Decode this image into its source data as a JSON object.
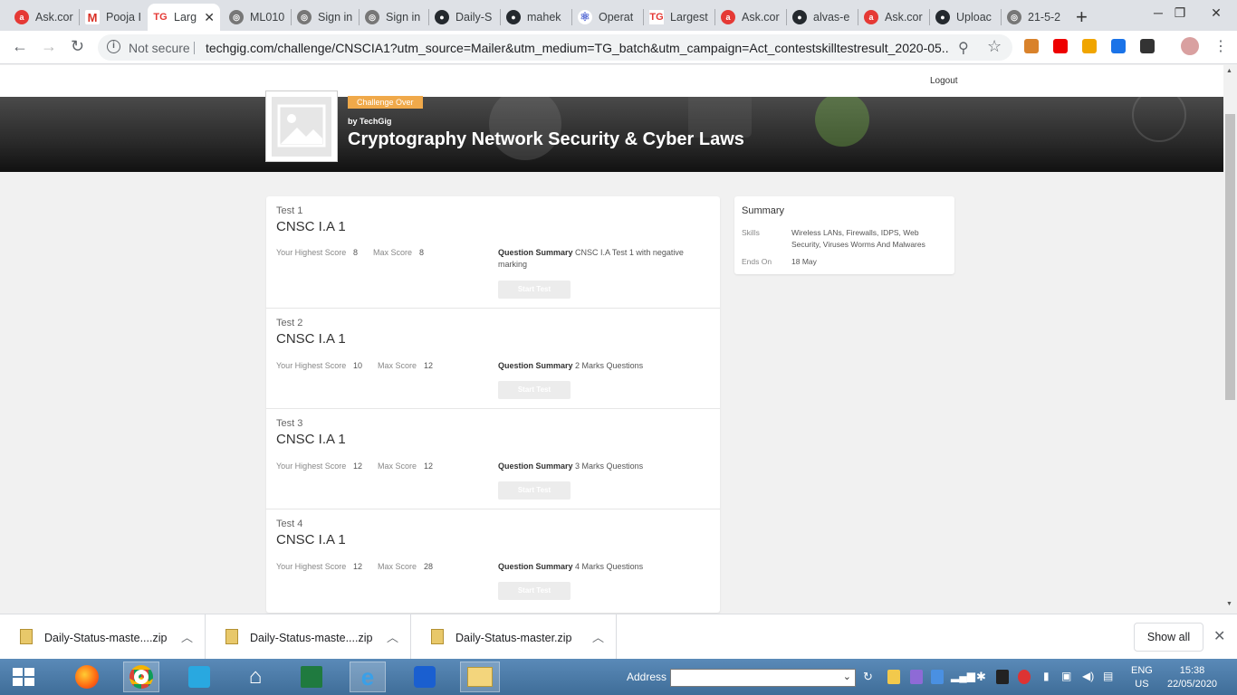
{
  "browser": {
    "tabs": [
      {
        "label": "Ask.cor",
        "fav": "ask"
      },
      {
        "label": "Pooja I",
        "fav": "gmail"
      },
      {
        "label": "Larg",
        "fav": "tg",
        "active": true
      },
      {
        "label": "ML010",
        "fav": "globe"
      },
      {
        "label": "Sign in",
        "fav": "globe"
      },
      {
        "label": "Sign in",
        "fav": "globe"
      },
      {
        "label": "Daily-S",
        "fav": "github"
      },
      {
        "label": "mahek",
        "fav": "github"
      },
      {
        "label": "Operat",
        "fav": "react"
      },
      {
        "label": "Largest",
        "fav": "tg"
      },
      {
        "label": "Ask.cor",
        "fav": "ask"
      },
      {
        "label": "alvas-e",
        "fav": "github"
      },
      {
        "label": "Ask.cor",
        "fav": "ask"
      },
      {
        "label": "Uploac",
        "fav": "github"
      },
      {
        "label": "21-5-2",
        "fav": "globe"
      }
    ],
    "security_label": "Not secure",
    "url": "techgig.com/challenge/CNSCIA1?utm_source=Mailer&utm_medium=TG_batch&utm_campaign=Act_contestskilltestresult_2020-05..."
  },
  "page": {
    "logout_label": "Logout",
    "badge": "Challenge Over",
    "by": "by TechGig",
    "title": "Cryptography Network Security & Cyber Laws",
    "tests": [
      {
        "num": "Test 1",
        "name": "CNSC I.A 1",
        "highest_label": "Your Highest Score",
        "highest": "8",
        "max_label": "Max Score",
        "max": "8",
        "qs_label": "Question Summary",
        "qs": "CNSC I.A Test 1 with negative marking",
        "button": "Start Test"
      },
      {
        "num": "Test 2",
        "name": "CNSC I.A 1",
        "highest_label": "Your Highest Score",
        "highest": "10",
        "max_label": "Max Score",
        "max": "12",
        "qs_label": "Question Summary",
        "qs": "2 Marks Questions",
        "button": "Start Test"
      },
      {
        "num": "Test 3",
        "name": "CNSC I.A 1",
        "highest_label": "Your Highest Score",
        "highest": "12",
        "max_label": "Max Score",
        "max": "12",
        "qs_label": "Question Summary",
        "qs": "3 Marks Questions",
        "button": "Start Test"
      },
      {
        "num": "Test 4",
        "name": "CNSC I.A 1",
        "highest_label": "Your Highest Score",
        "highest": "12",
        "max_label": "Max Score",
        "max": "28",
        "qs_label": "Question Summary",
        "qs": "4 Marks Questions",
        "button": "Start Test"
      }
    ],
    "summary": {
      "heading": "Summary",
      "skills_label": "Skills",
      "skills": "Wireless LANs, Firewalls, IDPS, Web Security, Viruses Worms And Malwares",
      "ends_label": "Ends On",
      "ends": "18 May"
    }
  },
  "downloads": {
    "items": [
      {
        "name": "Daily-Status-maste....zip"
      },
      {
        "name": "Daily-Status-maste....zip"
      },
      {
        "name": "Daily-Status-master.zip"
      }
    ],
    "show_all": "Show all"
  },
  "taskbar": {
    "address_label": "Address",
    "lang_line1": "ENG",
    "lang_line2": "US",
    "time": "15:38",
    "date": "22/05/2020"
  },
  "colors": {
    "badge": "#f0a94a",
    "accent_red": "#e53935"
  }
}
